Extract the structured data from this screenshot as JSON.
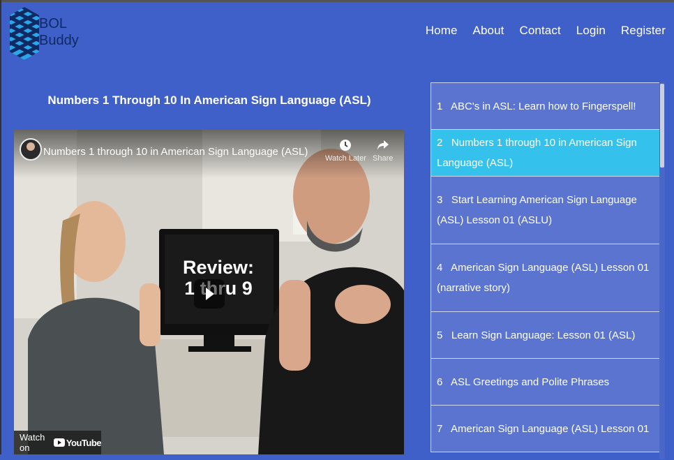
{
  "brand": {
    "line1": "BOL",
    "line2": "Buddy"
  },
  "nav": [
    "Home",
    "About",
    "Contact",
    "Login",
    "Register"
  ],
  "video": {
    "heading": "Numbers 1 Through 10 In American Sign Language (ASL)",
    "player_title": "Numbers 1 through 10 in American Sign Language (ASL)",
    "watch_later": "Watch Later",
    "share": "Share",
    "watch_on": "Watch on",
    "youtube": "YouTube",
    "screen_text_line1": "Review:",
    "screen_text_line2": "1 thru 9"
  },
  "playlist": [
    {
      "num": "1",
      "title": "ABC's in ASL: Learn how to Fingerspell!",
      "active": false
    },
    {
      "num": "2",
      "title": "Numbers 1 through 10 in American Sign Language (ASL)",
      "active": true
    },
    {
      "num": "3",
      "title": "Start Learning American Sign Language (ASL) Lesson 01 (ASLU)",
      "active": false
    },
    {
      "num": "4",
      "title": "American Sign Language (ASL) Lesson 01 (narrative story)",
      "active": false
    },
    {
      "num": "5",
      "title": "Learn Sign Language: Lesson 01 (ASL)",
      "active": false
    },
    {
      "num": "6",
      "title": "ASL Greetings and Polite Phrases",
      "active": false
    },
    {
      "num": "7",
      "title": "American Sign Language (ASL) Lesson 01",
      "active": false
    }
  ],
  "colors": {
    "page_bg": "#3f5fc9",
    "item_bg": "#5a74d0",
    "active_bg": "#34c2ec",
    "logo_dark": "#102a63",
    "logo_light": "#2aa7e8"
  }
}
